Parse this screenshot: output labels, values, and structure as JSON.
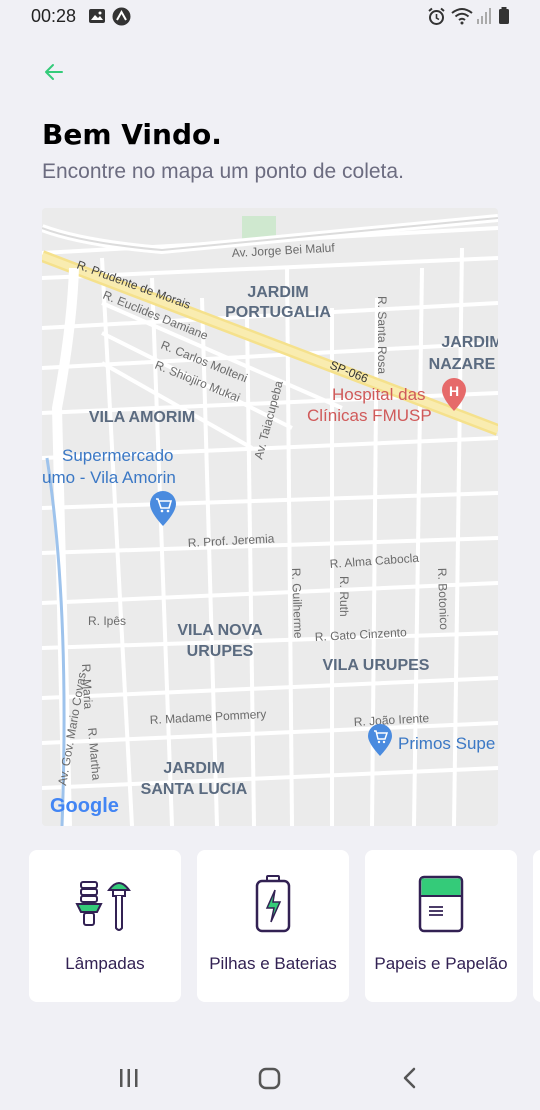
{
  "status": {
    "time": "00:28",
    "icons": [
      "gallery-icon",
      "app-badge-icon",
      "alarm-icon",
      "wifi-icon",
      "signal-icon",
      "battery-icon"
    ]
  },
  "header": {
    "back_icon": "arrow-left-icon",
    "title": "Bem Vindo.",
    "subtitle": "Encontre no mapa um ponto de coleta."
  },
  "map": {
    "logo": "Google",
    "neighborhoods": [
      "JARDIM",
      "PORTUGALIA",
      "JARDIM",
      "NAZARE",
      "VILA AMORIM",
      "VILA NOVA",
      "URUPES",
      "VILA URUPES",
      "JARDIM",
      "SANTA LUCIA"
    ],
    "streets": [
      "Av. Jorge Bei Maluf",
      "R. Prudente de Morais",
      "R. Euclides Damiane",
      "R. Carlos Molteni",
      "R. Shiojiro Mukai",
      "R. Santa Rosa",
      "SP-066",
      "Av. Taiacupeba",
      "R. Prof. Jeremia",
      "R. Alma Cabocla",
      "R. Ruth",
      "R. Guilherme",
      "R. Botonico",
      "R. Ipês",
      "R. Gato Cinzento",
      "R. Maria",
      "R. Martha",
      "Av. Gov. Mario Covas",
      "R. Madame Pommery",
      "R. João Irente"
    ],
    "places": [
      "Hospital das",
      "Clínicas FMUSP",
      "Supermercado",
      "umo - Vila Amorin",
      "Primos Supe"
    ]
  },
  "items": [
    {
      "label": "Lâmpadas",
      "icon": "lamp-icon"
    },
    {
      "label": "Pilhas e Baterias",
      "icon": "battery-icon"
    },
    {
      "label": "Papeis e Papelão",
      "icon": "paper-icon"
    }
  ],
  "nav": {
    "icons": [
      "recent-apps-icon",
      "home-icon",
      "back-nav-icon"
    ]
  },
  "colors": {
    "accent": "#34cb79",
    "title": "#322153",
    "subtitle": "#6c6c80",
    "background": "#f0f0f5"
  }
}
